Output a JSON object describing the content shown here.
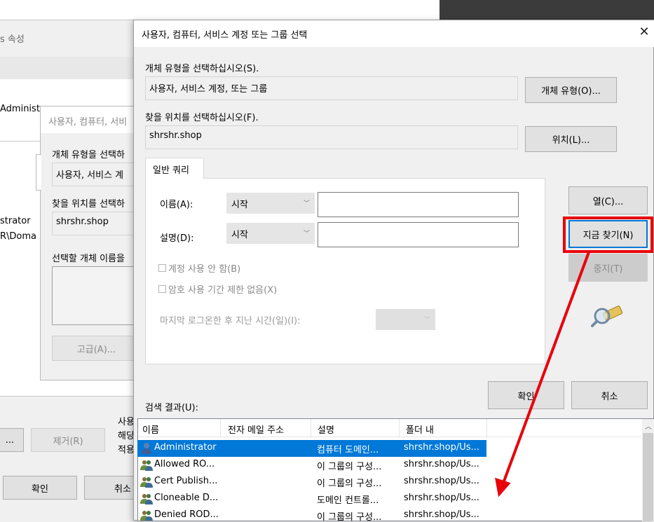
{
  "back1": {
    "title_partial": "s 속성",
    "admin_partial": "Administ",
    "list_line1": "strator",
    "list_line2": "R\\Doma",
    "remove_button": "제거(R)",
    "ellipsis_button": "...",
    "ok_button": "확인",
    "cancel_button": "취소",
    "note_line1": "사용",
    "note_line2": "해당",
    "note_line3": "적용"
  },
  "back2": {
    "title": "사용자, 컴퓨터, 서비",
    "object_type_label": "개체 유형을 선택하",
    "object_type_value": "사용자, 서비스 계",
    "location_label": "찾을 위치를 선택하",
    "location_value": "shrshr.shop",
    "enter_names_label": "선택할 개체 이름을",
    "advanced_button": "고급(A)..."
  },
  "dialog": {
    "title": "사용자, 컴퓨터, 서비스 계정 또는 그룹 선택",
    "object_type_label": "개체 유형을 선택하십시오(S).",
    "object_type_value": "사용자, 서비스 계정, 또는 그룹",
    "object_types_button": "개체 유형(O)...",
    "location_label": "찾을 위치를 선택하십시오(F).",
    "location_value": "shrshr.shop",
    "locations_button": "위치(L)...",
    "tab_label": "일반 쿼리",
    "name_label": "이름(A):",
    "name_mode": "시작",
    "name_value": "",
    "desc_label": "설명(D):",
    "desc_mode": "시작",
    "desc_value": "",
    "disabled_accounts": "계정 사용 안 함(B)",
    "non_expiring": "암호 사용 기간 제한 없음(X)",
    "last_logon_label": "마지막 로그온한 후 지난 시간(일)(I):",
    "last_logon_value": "",
    "columns_button": "열(C)...",
    "find_now_button": "지금 찾기(N)",
    "stop_button": "중지(T)",
    "ok_button": "확인",
    "cancel_button": "취소",
    "results_label": "검색 결과(U):",
    "results_columns": [
      "이름",
      "전자 메일 주소",
      "설명",
      "폴더 내"
    ],
    "results_rows": [
      {
        "name": "Administrator",
        "email": "",
        "desc": "컴퓨터 도메인...",
        "folder": "shrshr.shop/Us..."
      },
      {
        "name": "Allowed RO...",
        "email": "",
        "desc": "이 그룹의 구성...",
        "folder": "shrshr.shop/Us..."
      },
      {
        "name": "Cert Publish...",
        "email": "",
        "desc": "이 그룹의 구성...",
        "folder": "shrshr.shop/Us..."
      },
      {
        "name": "Cloneable D...",
        "email": "",
        "desc": "도메인 컨트롤...",
        "folder": "shrshr.shop/Us..."
      },
      {
        "name": "Denied ROD...",
        "email": "",
        "desc": "이 그룹의 구성...",
        "folder": "shrshr.shop/Us..."
      }
    ],
    "close_icon": "close-icon",
    "search_icon": "search-flashlight-icon"
  },
  "colors": {
    "highlight": "#0078d7",
    "annotation": "#e8000b",
    "dark_bg": "#3b3b3b"
  }
}
